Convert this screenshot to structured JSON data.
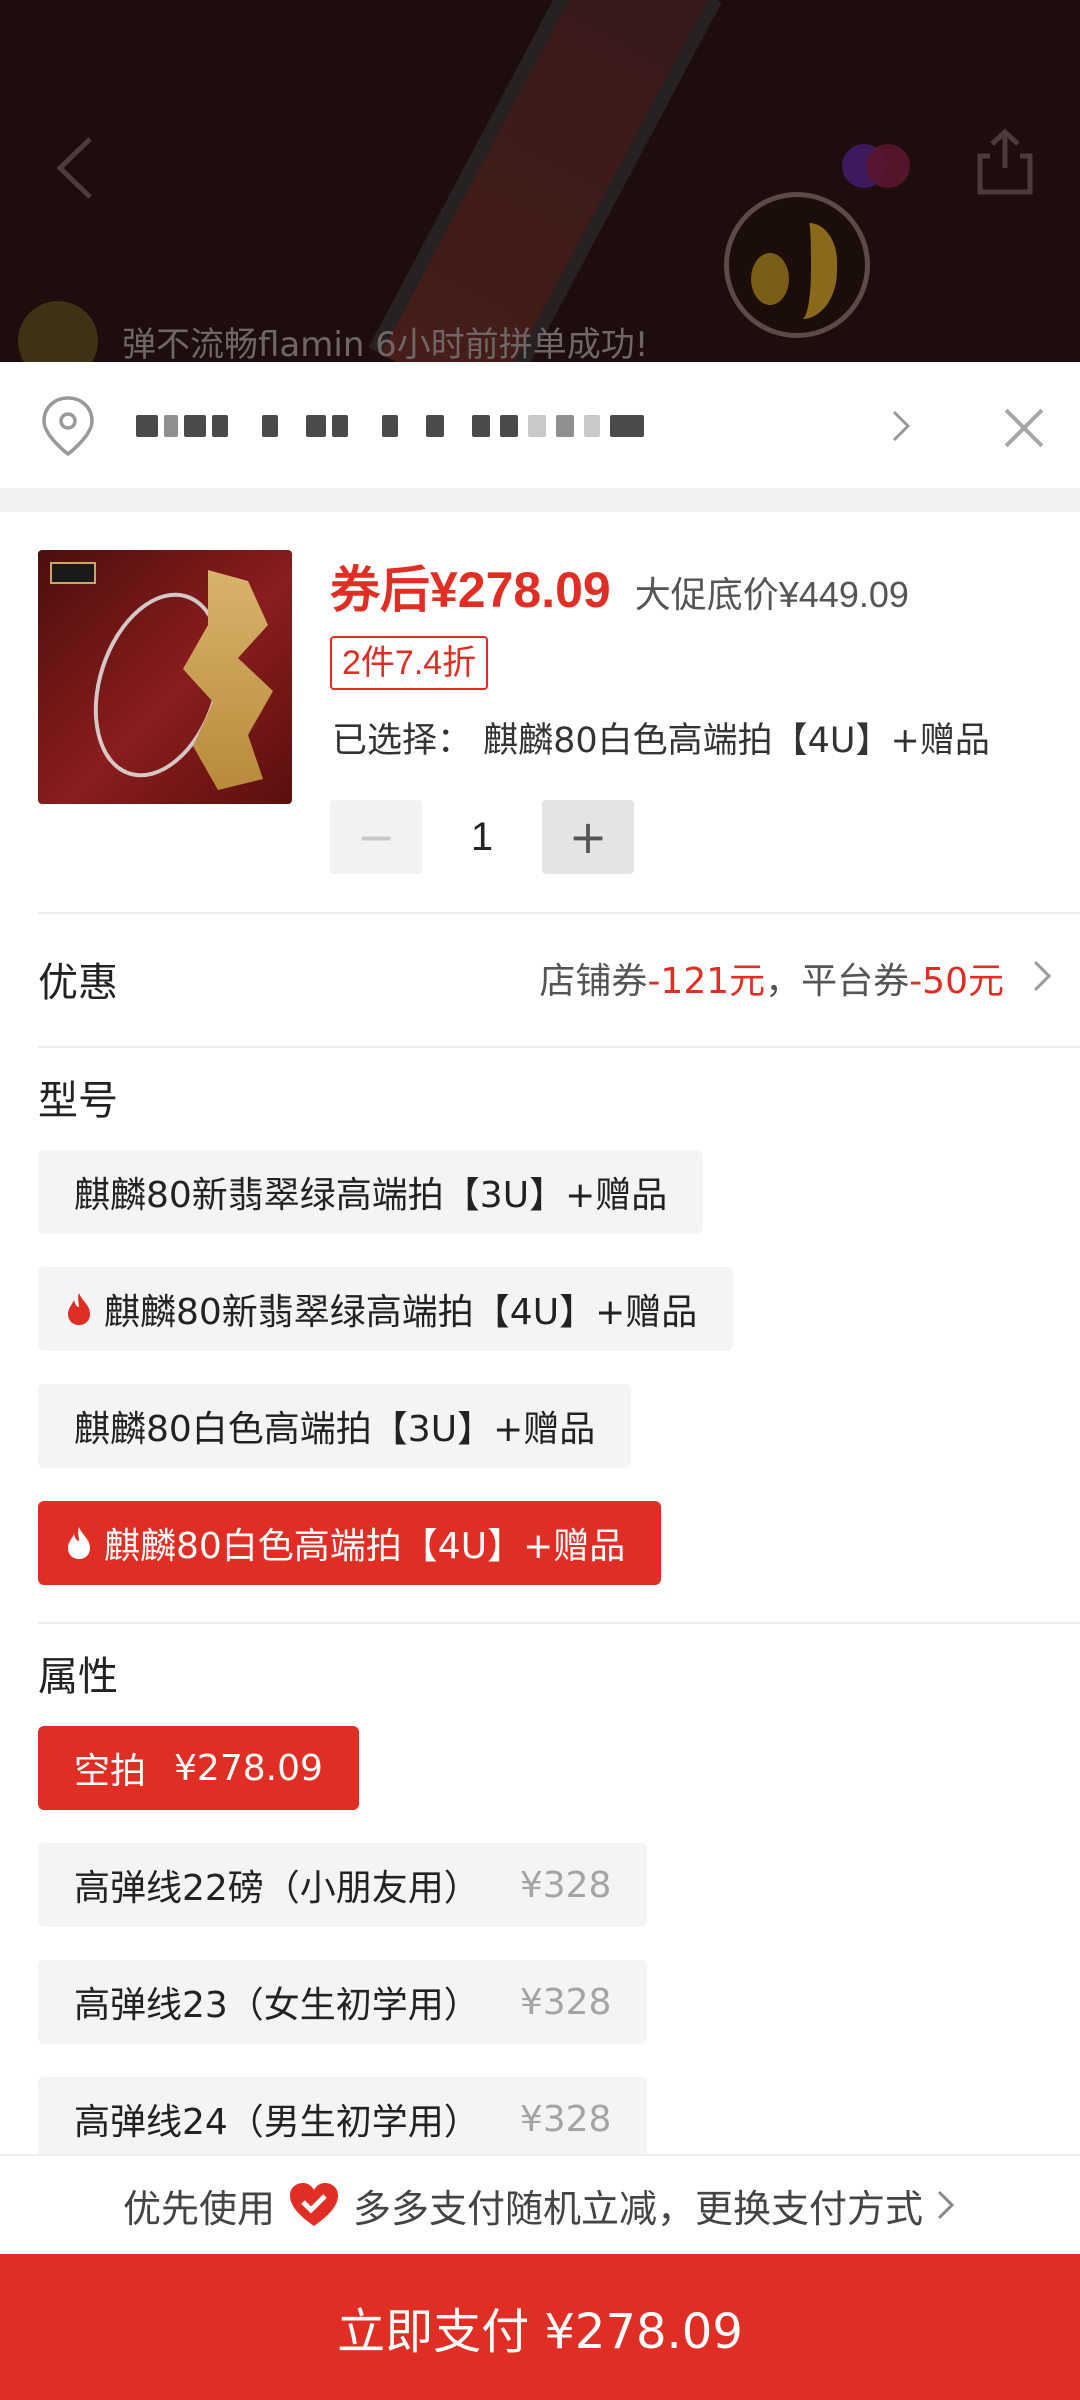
{
  "header": {
    "buyer_notice": "弹不流畅flamin 6小时前拼单成功!",
    "back_icon": "chevron-left-icon",
    "share_icon": "share-icon"
  },
  "address": {
    "value": "■■■■ ■■■ ■ ■■■■■",
    "pin_icon": "location-pin-icon",
    "close_icon": "close-icon"
  },
  "product": {
    "price_after_coupon": "券后¥278.09",
    "promo_base_price": "大促底价¥449.09",
    "discount_tag": "2件7.4折",
    "selected": "已选择：  麒麟80白色高端拍【4U】+赠品",
    "quantity": "1",
    "minus_label": "−",
    "plus_label": "+"
  },
  "coupon": {
    "label": "优惠",
    "store_coupon_label": "店铺券",
    "store_coupon_value": "-121元",
    "separator": "，",
    "platform_coupon_label": "平台券",
    "platform_coupon_value": "-50元"
  },
  "model": {
    "title": "型号",
    "options": [
      {
        "label": "麒麟80新翡翠绿高端拍【3U】+赠品",
        "hot": false,
        "selected": false
      },
      {
        "label": "麒麟80新翡翠绿高端拍【4U】+赠品",
        "hot": true,
        "selected": false
      },
      {
        "label": "麒麟80白色高端拍【3U】+赠品",
        "hot": false,
        "selected": false
      },
      {
        "label": "麒麟80白色高端拍【4U】+赠品",
        "hot": true,
        "selected": true
      }
    ]
  },
  "attribute": {
    "title": "属性",
    "options": [
      {
        "label": "空拍",
        "price": "¥278.09",
        "selected": true
      },
      {
        "label": "高弹线22磅（小朋友用）",
        "price": "¥328",
        "selected": false
      },
      {
        "label": "高弹线23（女生初学用）",
        "price": "¥328",
        "selected": false
      },
      {
        "label": "高弹线24（男生初学用）",
        "price": "¥328",
        "selected": false
      }
    ]
  },
  "payment": {
    "prefer_label": "优先使用",
    "method_text": "多多支付随机立减，更换支付方式",
    "pay_button": "立即支付 ¥278.09"
  },
  "colors": {
    "accent": "#e02e24",
    "chip_bg": "#f4f4f4",
    "muted_price": "#a4a4a4"
  }
}
